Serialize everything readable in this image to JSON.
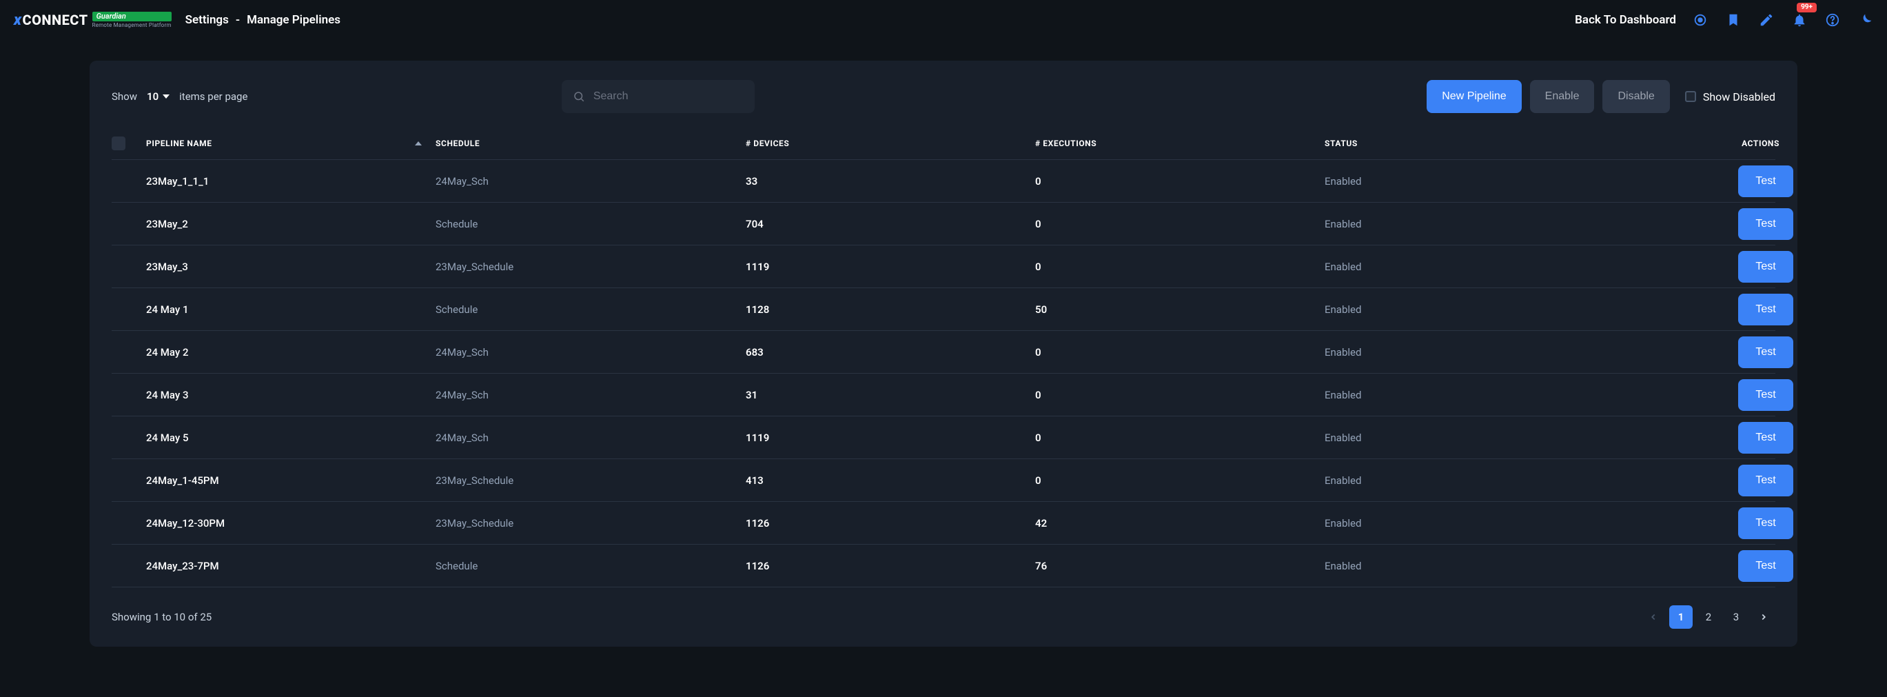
{
  "brand": {
    "x": "x",
    "connect": "CONNECT",
    "guardian": "Guardian",
    "tagline": "Remote Management Platform"
  },
  "breadcrumb": {
    "a": "Settings",
    "sep": "-",
    "b": "Manage Pipelines"
  },
  "header": {
    "back": "Back To Dashboard",
    "notif_badge": "99+"
  },
  "controls": {
    "show": "Show",
    "page_size": "10",
    "items_per_page": "items per page",
    "search_placeholder": "Search",
    "new_pipeline": "New Pipeline",
    "enable": "Enable",
    "disable": "Disable",
    "show_disabled": "Show Disabled"
  },
  "columns": {
    "name": "Pipeline Name",
    "schedule": "Schedule",
    "devices": "# Devices",
    "executions": "# Executions",
    "status": "Status",
    "actions": "Actions"
  },
  "rows": [
    {
      "name": "23May_1_1_1",
      "schedule": "24May_Sch",
      "devices": "33",
      "executions": "0",
      "status": "Enabled",
      "action": "Test"
    },
    {
      "name": "23May_2",
      "schedule": "Schedule",
      "devices": "704",
      "executions": "0",
      "status": "Enabled",
      "action": "Test"
    },
    {
      "name": "23May_3",
      "schedule": "23May_Schedule",
      "devices": "1119",
      "executions": "0",
      "status": "Enabled",
      "action": "Test"
    },
    {
      "name": "24 May 1",
      "schedule": "Schedule",
      "devices": "1128",
      "executions": "50",
      "status": "Enabled",
      "action": "Test"
    },
    {
      "name": "24 May 2",
      "schedule": "24May_Sch",
      "devices": "683",
      "executions": "0",
      "status": "Enabled",
      "action": "Test"
    },
    {
      "name": "24 May 3",
      "schedule": "24May_Sch",
      "devices": "31",
      "executions": "0",
      "status": "Enabled",
      "action": "Test"
    },
    {
      "name": "24 May 5",
      "schedule": "24May_Sch",
      "devices": "1119",
      "executions": "0",
      "status": "Enabled",
      "action": "Test"
    },
    {
      "name": "24May_1-45PM",
      "schedule": "23May_Schedule",
      "devices": "413",
      "executions": "0",
      "status": "Enabled",
      "action": "Test"
    },
    {
      "name": "24May_12-30PM",
      "schedule": "23May_Schedule",
      "devices": "1126",
      "executions": "42",
      "status": "Enabled",
      "action": "Test"
    },
    {
      "name": "24May_23-7PM",
      "schedule": "Schedule",
      "devices": "1126",
      "executions": "76",
      "status": "Enabled",
      "action": "Test"
    }
  ],
  "footer": {
    "range": "Showing 1 to 10 of 25",
    "pages": [
      "1",
      "2",
      "3"
    ],
    "active_page": "1"
  }
}
